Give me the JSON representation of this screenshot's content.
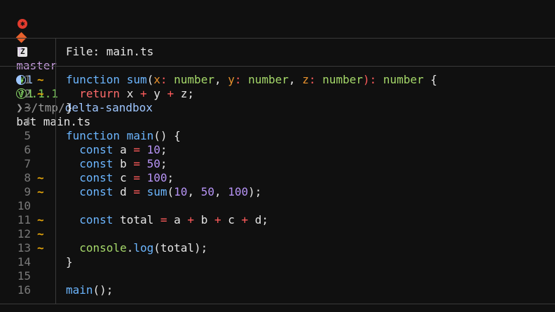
{
  "prompt": {
    "version": "v2.1.1",
    "path": "~/tmp/delta-sandbox",
    "branch": "master",
    "modified_count": "1",
    "untracked_count": "1",
    "chevron": "❯",
    "command": "bat main.ts",
    "os_glyph": "✱",
    "z_glyph": "Z",
    "node_glyph": "❦",
    "branch_glyph": "ᛘ",
    "question_glyph": "?"
  },
  "viewer": {
    "file_label": "File: main.ts",
    "change_marker": "~",
    "line_numbers": [
      "1",
      "2",
      "3",
      "4",
      "5",
      "6",
      "7",
      "8",
      "9",
      "10",
      "11",
      "12",
      "13",
      "14",
      "15",
      "16"
    ],
    "changed_lines": [
      1,
      2,
      8,
      9,
      11,
      12,
      13
    ],
    "code_lines": [
      [
        [
          "function ",
          "kw"
        ],
        [
          "sum",
          "fn"
        ],
        [
          "(",
          "p"
        ],
        [
          "x",
          "param"
        ],
        [
          ": ",
          "op"
        ],
        [
          "number",
          "type"
        ],
        [
          ", ",
          "p"
        ],
        [
          "y",
          "param"
        ],
        [
          ": ",
          "op"
        ],
        [
          "number",
          "type"
        ],
        [
          ", ",
          "p"
        ],
        [
          "z",
          "param"
        ],
        [
          ": ",
          "op"
        ],
        [
          "number",
          "type"
        ],
        [
          "): ",
          "op"
        ],
        [
          "number",
          "type"
        ],
        [
          " {",
          "p"
        ]
      ],
      [
        [
          "  ",
          "p"
        ],
        [
          "return",
          "ret"
        ],
        [
          " x ",
          "p"
        ],
        [
          "+",
          "op"
        ],
        [
          " y ",
          "p"
        ],
        [
          "+",
          "op"
        ],
        [
          " z;",
          "p"
        ]
      ],
      [
        [
          "}",
          "p"
        ]
      ],
      [],
      [
        [
          "function ",
          "kw"
        ],
        [
          "main",
          "fn"
        ],
        [
          "() {",
          "p"
        ]
      ],
      [
        [
          "  ",
          "p"
        ],
        [
          "const",
          "kw"
        ],
        [
          " a ",
          "p"
        ],
        [
          "=",
          "op"
        ],
        [
          " ",
          "p"
        ],
        [
          "10",
          "num"
        ],
        [
          ";",
          "p"
        ]
      ],
      [
        [
          "  ",
          "p"
        ],
        [
          "const",
          "kw"
        ],
        [
          " b ",
          "p"
        ],
        [
          "=",
          "op"
        ],
        [
          " ",
          "p"
        ],
        [
          "50",
          "num"
        ],
        [
          ";",
          "p"
        ]
      ],
      [
        [
          "  ",
          "p"
        ],
        [
          "const",
          "kw"
        ],
        [
          " c ",
          "p"
        ],
        [
          "=",
          "op"
        ],
        [
          " ",
          "p"
        ],
        [
          "100",
          "num"
        ],
        [
          ";",
          "p"
        ]
      ],
      [
        [
          "  ",
          "p"
        ],
        [
          "const",
          "kw"
        ],
        [
          " d ",
          "p"
        ],
        [
          "=",
          "op"
        ],
        [
          " ",
          "p"
        ],
        [
          "sum",
          "fn"
        ],
        [
          "(",
          "p"
        ],
        [
          "10",
          "num"
        ],
        [
          ", ",
          "p"
        ],
        [
          "50",
          "num"
        ],
        [
          ", ",
          "p"
        ],
        [
          "100",
          "num"
        ],
        [
          ");",
          "p"
        ]
      ],
      [],
      [
        [
          "  ",
          "p"
        ],
        [
          "const",
          "kw"
        ],
        [
          " total ",
          "p"
        ],
        [
          "=",
          "op"
        ],
        [
          " a ",
          "p"
        ],
        [
          "+",
          "op"
        ],
        [
          " b ",
          "p"
        ],
        [
          "+",
          "op"
        ],
        [
          " c ",
          "p"
        ],
        [
          "+",
          "op"
        ],
        [
          " d;",
          "p"
        ]
      ],
      [],
      [
        [
          "  ",
          "p"
        ],
        [
          "console",
          "type"
        ],
        [
          ".",
          "p"
        ],
        [
          "log",
          "fn"
        ],
        [
          "(total);",
          "p"
        ]
      ],
      [
        [
          "}",
          "p"
        ]
      ],
      [],
      [
        [
          "main",
          "fn"
        ],
        [
          "();",
          "p"
        ]
      ]
    ]
  },
  "colors": {
    "background": "#101010",
    "version": "#7ccf5a",
    "path": "#9a9a9a",
    "path_highlight": "#9ec6ff",
    "branch": "#c49bdc",
    "modified": "#9ec6ff",
    "untracked": "#8bd36a",
    "kw": "#6cb6ff",
    "fn": "#6cb6ff",
    "param": "#e8912d",
    "op": "#ff5c5c",
    "type": "#a6d96a",
    "ret": "#ff6b6b",
    "num": "#b794f6",
    "p": "#e6e6e6",
    "gutter": "#7a7a7a",
    "marker": "#e5a50a"
  }
}
